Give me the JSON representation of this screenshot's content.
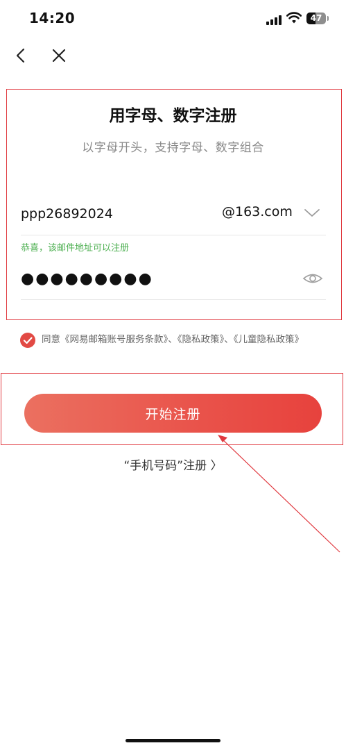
{
  "status_bar": {
    "time": "14:20",
    "battery": "47",
    "battery_level": 0.47
  },
  "form": {
    "title": "用字母、数字注册",
    "subtitle": "以字母开头，支持字母、数字组合",
    "email_value": "ppp26892024",
    "domain": "@163.com",
    "success_message": "恭喜，该邮件地址可以注册",
    "password_value": "●●●●●●●●●"
  },
  "agreement": {
    "checked": true,
    "text": "同意《网易邮箱账号服务条款》、《隐私政策》、《儿童隐私政策》"
  },
  "register_button": {
    "label": "开始注册"
  },
  "phone_register_link": {
    "label": "“手机号码”注册 〉"
  },
  "colors": {
    "accent": "#e24a44",
    "success": "#4caf50",
    "annotation": "#e0393f"
  },
  "icons": {
    "back": "chevron-left-icon",
    "close": "close-icon",
    "domain_dropdown": "chevron-down-icon",
    "password_visibility": "eye-icon",
    "agree": "checkmark-icon"
  }
}
